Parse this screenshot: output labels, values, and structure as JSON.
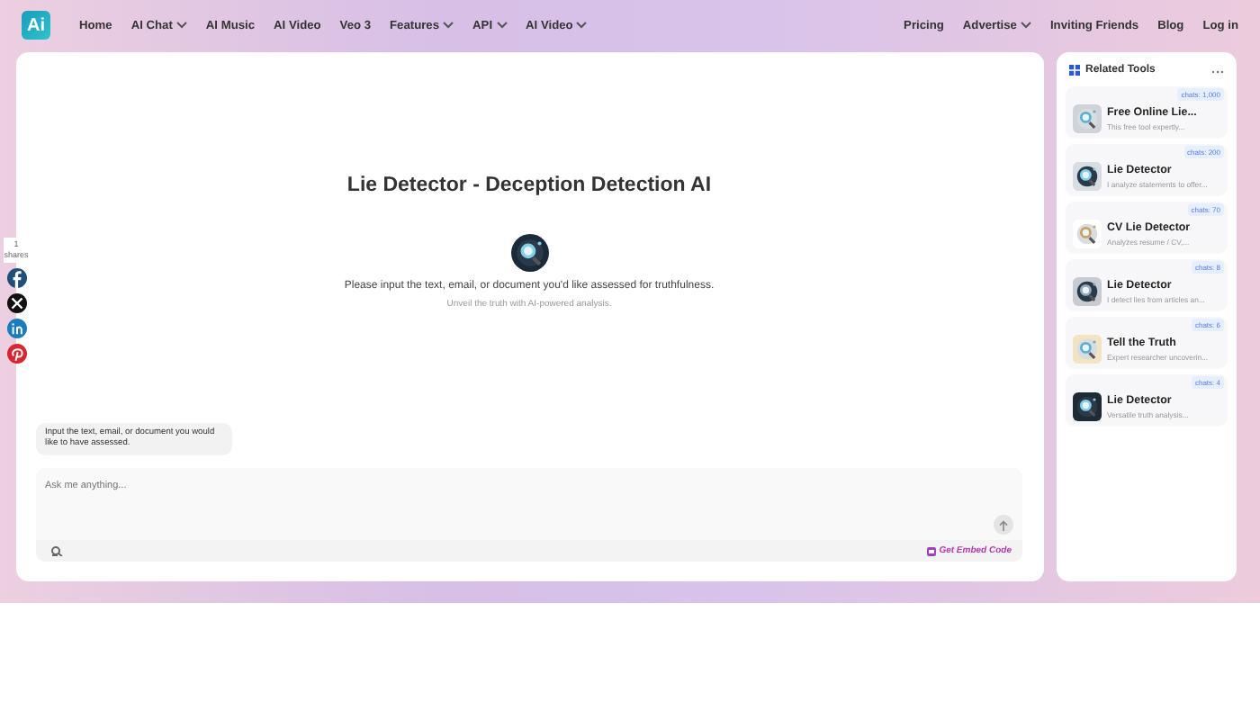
{
  "logo": "Ai",
  "nav_left": [
    {
      "label": "Home",
      "dropdown": false
    },
    {
      "label": "AI Chat",
      "dropdown": true
    },
    {
      "label": "AI Music",
      "dropdown": false
    },
    {
      "label": "AI Video",
      "dropdown": false
    },
    {
      "label": "Veo 3",
      "dropdown": false
    },
    {
      "label": "Features",
      "dropdown": true
    },
    {
      "label": "API",
      "dropdown": true
    },
    {
      "label": "AI Video",
      "dropdown": true
    }
  ],
  "nav_right": [
    {
      "label": "Pricing",
      "dropdown": false
    },
    {
      "label": "Advertise",
      "dropdown": true
    },
    {
      "label": "Inviting Friends",
      "dropdown": false
    },
    {
      "label": "Blog",
      "dropdown": false
    },
    {
      "label": "Log in",
      "dropdown": false
    }
  ],
  "share": {
    "count": "1",
    "label": "shares",
    "buttons": [
      {
        "kind": "facebook",
        "color": "#1f4e79"
      },
      {
        "kind": "x",
        "color": "#111111"
      },
      {
        "kind": "linkedin",
        "color": "#1a7bbf"
      },
      {
        "kind": "pinterest",
        "color": "#d9262e"
      }
    ]
  },
  "chat": {
    "title": "Lie Detector - Deception Detection AI",
    "prompt": "Please input the text, email, or document you'd like assessed for truthfulness.",
    "subtitle": "Unveil the truth with AI-powered analysis.",
    "message": "Input the text, email, or document you would like to have assessed.",
    "input": {
      "placeholder": "Ask me anything..."
    },
    "embed": "Get Embed Code"
  },
  "related": {
    "title": "Related Tools",
    "tools": [
      {
        "name": "Free Online Lie...",
        "description": "This free tool expertly...",
        "chats": "chats: 1,000"
      },
      {
        "name": "Lie Detector",
        "description": "I analyze statements to offer...",
        "chats": "chats: 200"
      },
      {
        "name": "CV Lie Detector",
        "description": "Analyzes resume / CV,...",
        "chats": "chats: 70"
      },
      {
        "name": "Lie Detector",
        "description": "I detect lies from articles an...",
        "chats": "chats: 8"
      },
      {
        "name": "Tell the Truth",
        "description": "Expert researcher uncoverin...",
        "chats": "chats: 6"
      },
      {
        "name": "Lie Detector",
        "description": "Versatile truth analysis...",
        "chats": "chats: 4"
      }
    ]
  }
}
